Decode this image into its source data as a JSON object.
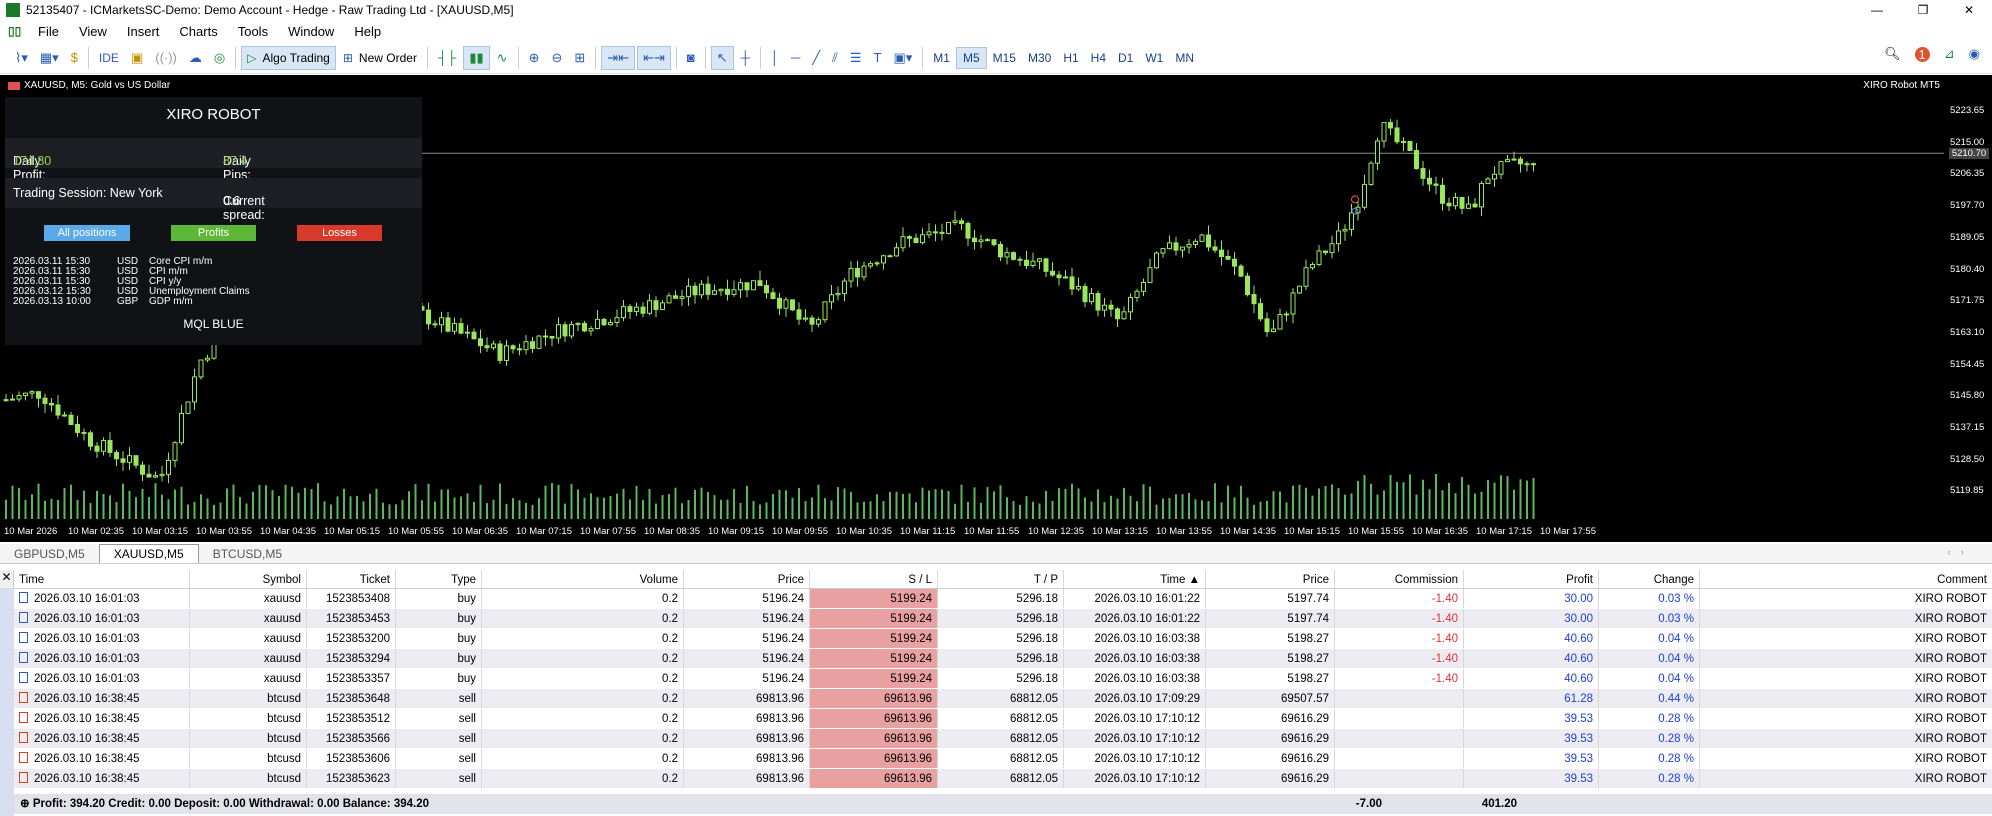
{
  "window": {
    "title": "52135407 - ICMarketsSC-Demo: Demo Account - Hedge - Raw Trading Ltd - [XAUUSD,M5]",
    "controls": [
      "—",
      "❐",
      "✕"
    ]
  },
  "menu": [
    "File",
    "View",
    "Insert",
    "Charts",
    "Tools",
    "Window",
    "Help"
  ],
  "toolbar": {
    "ide_label": "IDE",
    "algo_trading_label": "Algo Trading",
    "new_order_label": "New Order",
    "timeframes": [
      "M1",
      "M5",
      "M15",
      "M30",
      "H1",
      "H4",
      "D1",
      "W1",
      "MN"
    ],
    "active_timeframe": "M5",
    "notification_count": "1"
  },
  "chart": {
    "symbol_label": "XAUUSD, M5:  Gold vs US Dollar",
    "ea_label": "XIRO Robot MT5",
    "current_price": "5210.70",
    "price_ticks": [
      "5223.65",
      "5215.00",
      "5206.35",
      "5197.70",
      "5189.05",
      "5180.40",
      "5171.75",
      "5163.10",
      "5154.45",
      "5145.80",
      "5137.15",
      "5128.50",
      "5119.85"
    ],
    "time_ticks": [
      "10 Mar 2026",
      "10 Mar 02:35",
      "10 Mar 03:15",
      "10 Mar 03:55",
      "10 Mar 04:35",
      "10 Mar 05:15",
      "10 Mar 05:55",
      "10 Mar 06:35",
      "10 Mar 07:15",
      "10 Mar 07:55",
      "10 Mar 08:35",
      "10 Mar 09:15",
      "10 Mar 09:55",
      "10 Mar 10:35",
      "10 Mar 11:15",
      "10 Mar 11:55",
      "10 Mar 12:35",
      "10 Mar 13:15",
      "10 Mar 13:55",
      "10 Mar 14:35",
      "10 Mar 15:15",
      "10 Mar 15:55",
      "10 Mar 16:35",
      "10 Mar 17:15",
      "10 Mar 17:55"
    ],
    "colors": {
      "background": "#000000",
      "candle": "#9ae65c",
      "volume": "#5cb85c"
    }
  },
  "robot_panel": {
    "title": "XIRO ROBOT",
    "daily_profit_label": "Daily Profit:",
    "daily_profit_value": "174.80",
    "daily_pips_label": "Daily Pips:",
    "daily_pips_value": "87.4",
    "session_label": "Trading Session: New York",
    "spread_label": "Current spread:",
    "spread_value": "0.6",
    "buttons": {
      "all": "All positions",
      "profits": "Profits",
      "losses": "Losses"
    },
    "news": [
      {
        "time": "2026.03.11 15:30",
        "cur": "USD",
        "event": "Core CPI m/m"
      },
      {
        "time": "2026.03.11 15:30",
        "cur": "USD",
        "event": "CPI m/m"
      },
      {
        "time": "2026.03.11 15:30",
        "cur": "USD",
        "event": "CPI y/y"
      },
      {
        "time": "2026.03.12 15:30",
        "cur": "USD",
        "event": "Unemployment Claims"
      },
      {
        "time": "2026.03.13 10:00",
        "cur": "GBP",
        "event": "GDP m/m"
      }
    ],
    "footer": "MQL BLUE"
  },
  "chart_tabs": [
    "GBPUSD,M5",
    "XAUUSD,M5",
    "BTCUSD,M5"
  ],
  "active_chart_tab": "XAUUSD,M5",
  "table": {
    "headers": [
      "Time",
      "Symbol",
      "Ticket",
      "Type",
      "Volume",
      "Price",
      "S / L",
      "T / P",
      "Time ▲",
      "Price",
      "Commission",
      "Profit",
      "Change",
      "Comment"
    ],
    "rows": [
      [
        "2026.03.10 16:01:03",
        "xauusd",
        "1523853408",
        "buy",
        "0.2",
        "5196.24",
        "5199.24",
        "5296.18",
        "2026.03.10 16:01:22",
        "5197.74",
        "-1.40",
        "30.00",
        "0.03 %",
        "XIRO ROBOT"
      ],
      [
        "2026.03.10 16:01:03",
        "xauusd",
        "1523853453",
        "buy",
        "0.2",
        "5196.24",
        "5199.24",
        "5296.18",
        "2026.03.10 16:01:22",
        "5197.74",
        "-1.40",
        "30.00",
        "0.03 %",
        "XIRO ROBOT"
      ],
      [
        "2026.03.10 16:01:03",
        "xauusd",
        "1523853200",
        "buy",
        "0.2",
        "5196.24",
        "5199.24",
        "5296.18",
        "2026.03.10 16:03:38",
        "5198.27",
        "-1.40",
        "40.60",
        "0.04 %",
        "XIRO ROBOT"
      ],
      [
        "2026.03.10 16:01:03",
        "xauusd",
        "1523853294",
        "buy",
        "0.2",
        "5196.24",
        "5199.24",
        "5296.18",
        "2026.03.10 16:03:38",
        "5198.27",
        "-1.40",
        "40.60",
        "0.04 %",
        "XIRO ROBOT"
      ],
      [
        "2026.03.10 16:01:03",
        "xauusd",
        "1523853357",
        "buy",
        "0.2",
        "5196.24",
        "5199.24",
        "5296.18",
        "2026.03.10 16:03:38",
        "5198.27",
        "-1.40",
        "40.60",
        "0.04 %",
        "XIRO ROBOT"
      ],
      [
        "2026.03.10 16:38:45",
        "btcusd",
        "1523853648",
        "sell",
        "0.2",
        "69813.96",
        "69613.96",
        "68812.05",
        "2026.03.10 17:09:29",
        "69507.57",
        "",
        "61.28",
        "0.44 %",
        "XIRO ROBOT"
      ],
      [
        "2026.03.10 16:38:45",
        "btcusd",
        "1523853512",
        "sell",
        "0.2",
        "69813.96",
        "69613.96",
        "68812.05",
        "2026.03.10 17:10:12",
        "69616.29",
        "",
        "39.53",
        "0.28 %",
        "XIRO ROBOT"
      ],
      [
        "2026.03.10 16:38:45",
        "btcusd",
        "1523853566",
        "sell",
        "0.2",
        "69813.96",
        "69613.96",
        "68812.05",
        "2026.03.10 17:10:12",
        "69616.29",
        "",
        "39.53",
        "0.28 %",
        "XIRO ROBOT"
      ],
      [
        "2026.03.10 16:38:45",
        "btcusd",
        "1523853606",
        "sell",
        "0.2",
        "69813.96",
        "69613.96",
        "68812.05",
        "2026.03.10 17:10:12",
        "69616.29",
        "",
        "39.53",
        "0.28 %",
        "XIRO ROBOT"
      ],
      [
        "2026.03.10 16:38:45",
        "btcusd",
        "1523853623",
        "sell",
        "0.2",
        "69813.96",
        "69613.96",
        "68812.05",
        "2026.03.10 17:10:12",
        "69616.29",
        "",
        "39.53",
        "0.28 %",
        "XIRO ROBOT"
      ]
    ],
    "footer_summary": "Profit: 394.20  Credit: 0.00  Deposit: 0.00  Withdrawal: 0.00  Balance: 394.20",
    "footer_commission": "-7.00",
    "footer_profit": "401.20"
  }
}
